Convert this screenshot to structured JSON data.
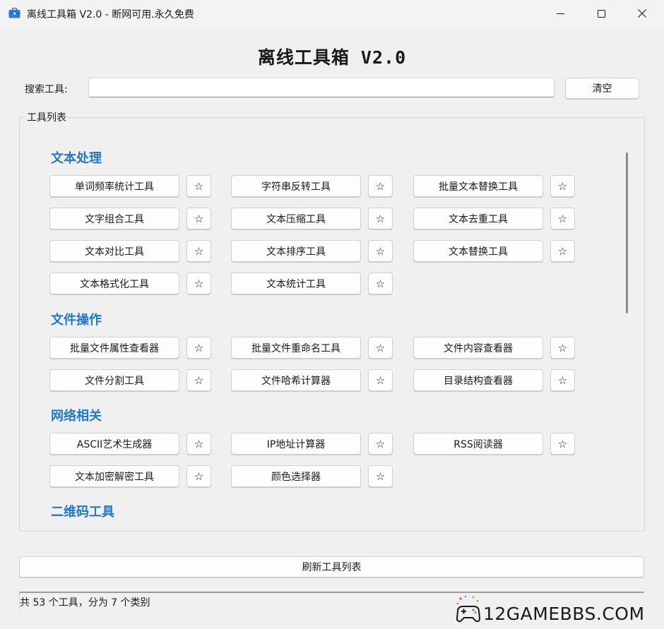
{
  "window": {
    "title": "离线工具箱 V2.0 - 断网可用.永久免费"
  },
  "header": {
    "title": "离线工具箱 V2.0"
  },
  "search": {
    "label": "搜索工具:",
    "value": "",
    "clear_label": "清空"
  },
  "tools_group": {
    "label": "工具列表",
    "star_glyph": "☆",
    "categories": [
      {
        "name": "文本处理",
        "tools": [
          "单词频率统计工具",
          "字符串反转工具",
          "批量文本替换工具",
          "文字组合工具",
          "文本压缩工具",
          "文本去重工具",
          "文本对比工具",
          "文本排序工具",
          "文本替换工具",
          "文本格式化工具",
          "文本统计工具"
        ]
      },
      {
        "name": "文件操作",
        "tools": [
          "批量文件属性查看器",
          "批量文件重命名工具",
          "文件内容查看器",
          "文件分割工具",
          "文件哈希计算器",
          "目录结构查看器"
        ]
      },
      {
        "name": "网络相关",
        "tools": [
          "ASCII艺术生成器",
          "IP地址计算器",
          "RSS阅读器",
          "文本加密解密工具",
          "颜色选择器"
        ]
      },
      {
        "name": "二维码工具",
        "tools": []
      }
    ]
  },
  "refresh_label": "刷新工具列表",
  "status_text": "共 53 个工具，分为 7 个类别",
  "watermark": {
    "text": "12GAMEBBS.COM"
  },
  "colors": {
    "category_title": "#2277c8",
    "window_bg": "#f0f0f0"
  }
}
